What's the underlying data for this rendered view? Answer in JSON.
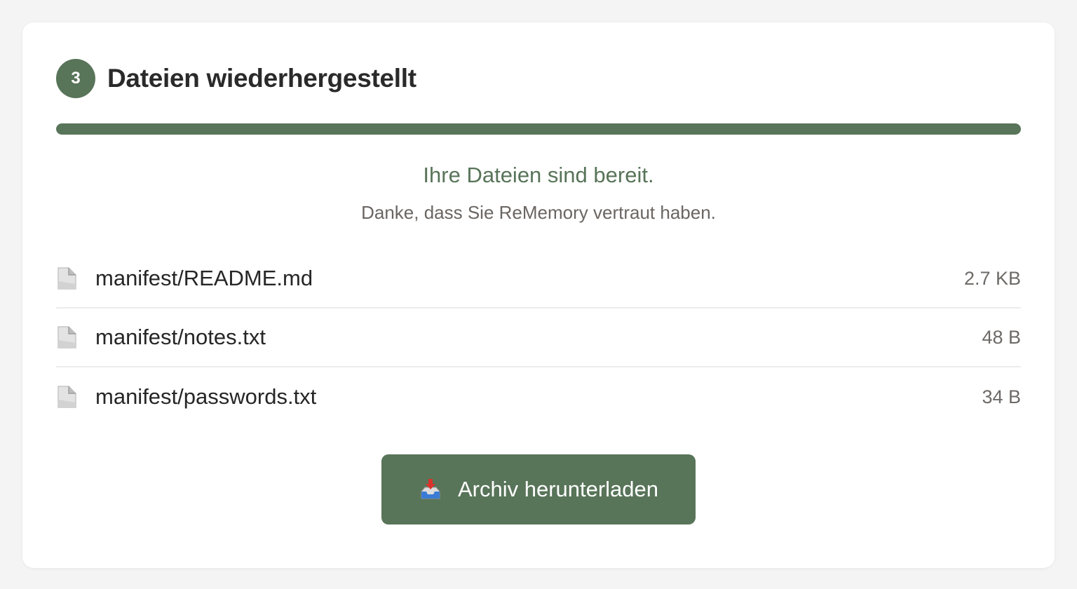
{
  "step": {
    "number": "3",
    "title": "Dateien wiederhergestellt"
  },
  "progress": {
    "fraction": 1.0
  },
  "messages": {
    "success": "Ihre Dateien sind bereit.",
    "thanks": "Danke, dass Sie ReMemory vertraut haben."
  },
  "files": [
    {
      "name": "manifest/README.md",
      "size": "2.7 KB",
      "icon": "file-icon"
    },
    {
      "name": "manifest/notes.txt",
      "size": "48 B",
      "icon": "file-icon"
    },
    {
      "name": "manifest/passwords.txt",
      "size": "34 B",
      "icon": "file-icon"
    }
  ],
  "download_button": {
    "label": "Archiv herunterladen",
    "icon": "inbox-tray-icon"
  },
  "colors": {
    "accent": "#587459",
    "success_text": "#587459",
    "background": "#f4f4f4",
    "card": "#ffffff"
  }
}
